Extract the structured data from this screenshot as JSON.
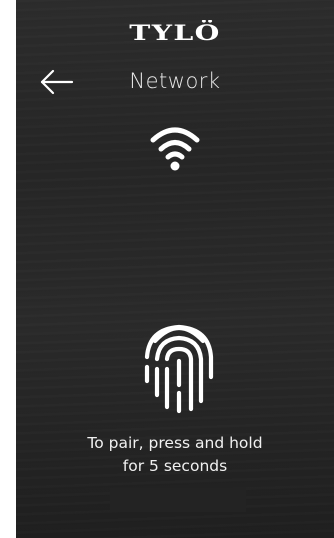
{
  "header": {
    "brand": "TYLÖ",
    "title": "Network"
  },
  "icons": {
    "back": "back-arrow-icon",
    "wifi": "wifi-icon",
    "fingerprint": "fingerprint-icon"
  },
  "instruction": {
    "line1": "To pair, press and hold",
    "line2": "for 5 seconds"
  },
  "progress": {
    "value": 0
  },
  "colors": {
    "background": "#2a2a2a",
    "foreground": "#ffffff"
  }
}
